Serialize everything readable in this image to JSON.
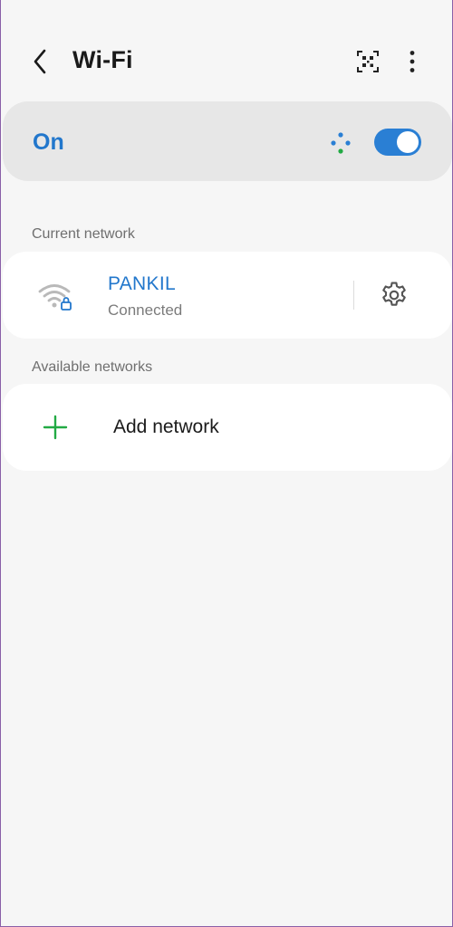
{
  "header": {
    "title": "Wi-Fi",
    "back_icon": "back-arrow-icon",
    "qr_icon": "qr-code-icon",
    "more_icon": "more-vertical-icon"
  },
  "master_switch": {
    "label": "On",
    "state": true,
    "accent_color": "#2277cc",
    "toggle_color": "#2a7fd4"
  },
  "current_network": {
    "section_title": "Current network",
    "name": "PANKIL",
    "status": "Connected",
    "icon": "wifi-lock-icon",
    "settings_icon": "gear-icon"
  },
  "available_networks": {
    "section_title": "Available networks",
    "add_label": "Add network",
    "add_icon": "plus-icon",
    "add_color": "#22aa44"
  }
}
